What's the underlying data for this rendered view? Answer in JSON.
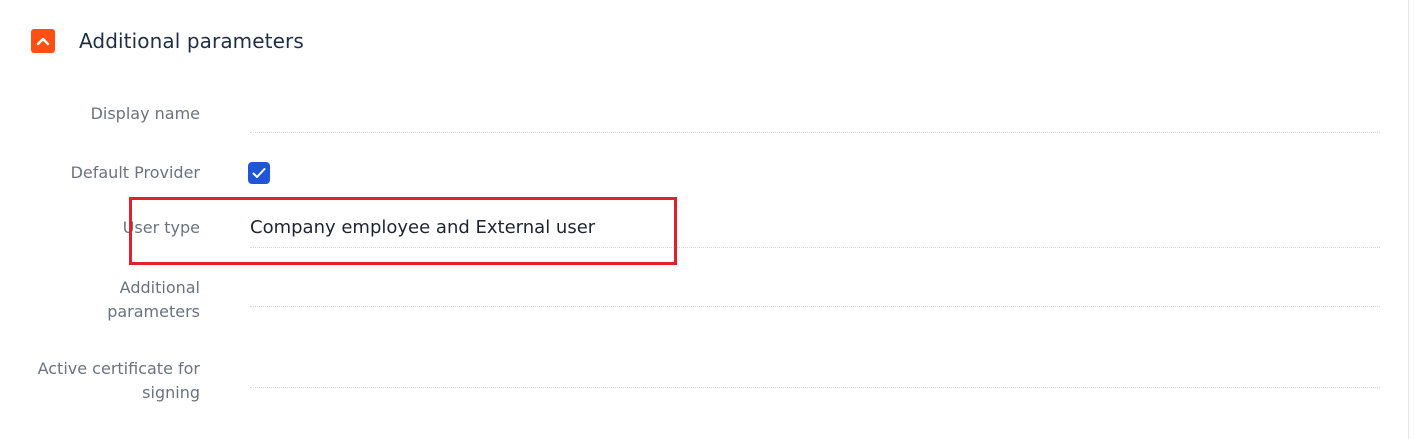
{
  "section": {
    "title": "Additional parameters",
    "toggle_icon": "chevron-up-icon",
    "accent_color": "#ff4f12"
  },
  "fields": {
    "display_name": {
      "label": "Display name",
      "value": ""
    },
    "default_provider": {
      "label": "Default Provider",
      "checked": true,
      "checkbox_color": "#1f56d8"
    },
    "user_type": {
      "label": "User type",
      "value": "Company employee and External user"
    },
    "additional_parameters": {
      "label_line1": "Additional",
      "label_line2": "parameters",
      "value": ""
    },
    "active_certificate": {
      "label_line1": "Active certificate for",
      "label_line2": "signing",
      "value": ""
    }
  },
  "highlight": {
    "color": "#e0202a",
    "target": "user-type-row"
  }
}
